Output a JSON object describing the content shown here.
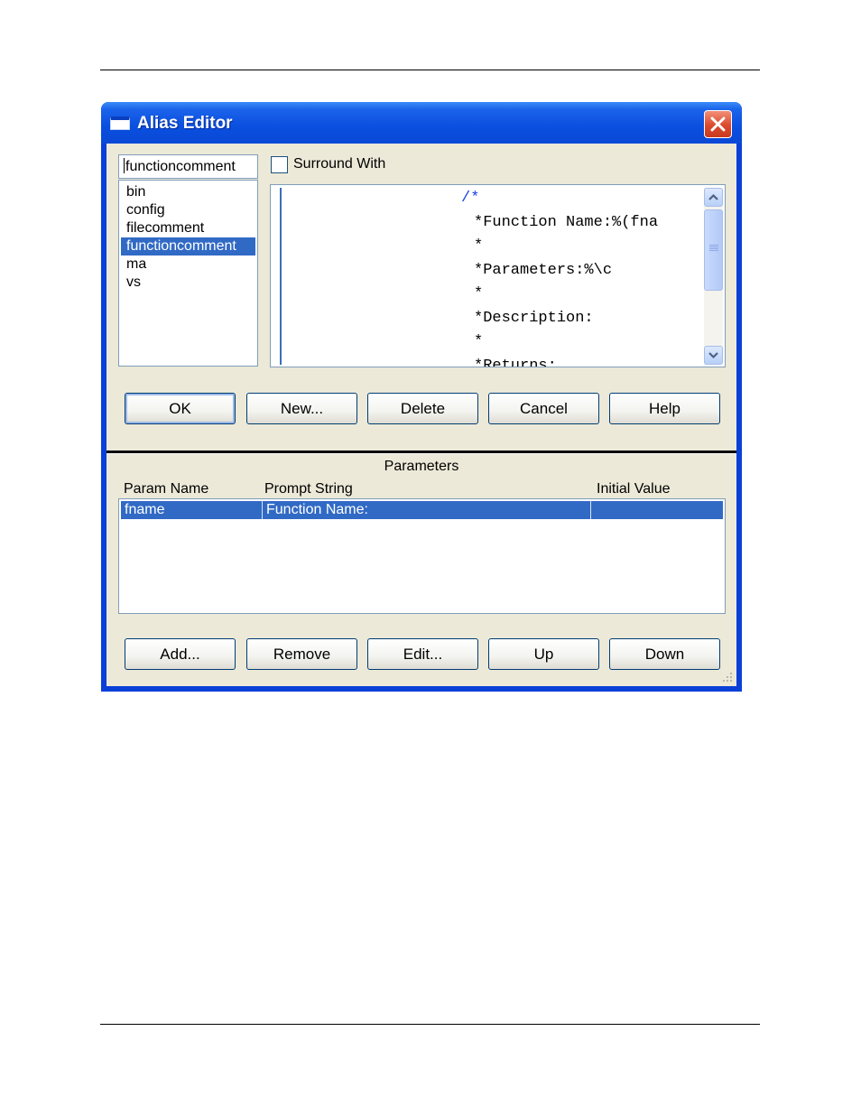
{
  "window": {
    "title": "Alias Editor"
  },
  "alias_name_field": {
    "value": "functioncomment"
  },
  "alias_list": {
    "items": [
      "bin",
      "config",
      "filecomment",
      "functioncomment",
      "ma",
      "vs"
    ],
    "selected": "functioncomment"
  },
  "surround_with": {
    "label": "Surround With",
    "checked": false
  },
  "code": {
    "open_comment": "/*",
    "line1": "*Function Name:%(fna",
    "line2": "*",
    "line3": "*Parameters:%\\c",
    "line4": "*",
    "line5": "*Description:",
    "line6": "*",
    "line7": "*Returns:"
  },
  "top_buttons": {
    "ok": "OK",
    "new": "New...",
    "delete": "Delete",
    "cancel": "Cancel",
    "help": "Help"
  },
  "parameters": {
    "label": "Parameters",
    "columns": [
      "Param Name",
      "Prompt String",
      "Initial Value"
    ],
    "rows": [
      {
        "param_name": "fname",
        "prompt_string": "Function Name:",
        "initial_value": ""
      }
    ]
  },
  "bottom_buttons": {
    "add": "Add...",
    "remove": "Remove",
    "edit": "Edit...",
    "up": "Up",
    "down": "Down"
  },
  "colors": {
    "title_bar": "#0a4fdf",
    "selection": "#316ac5",
    "dialog_face": "#ece9d8",
    "close_button": "#db4a2c"
  }
}
